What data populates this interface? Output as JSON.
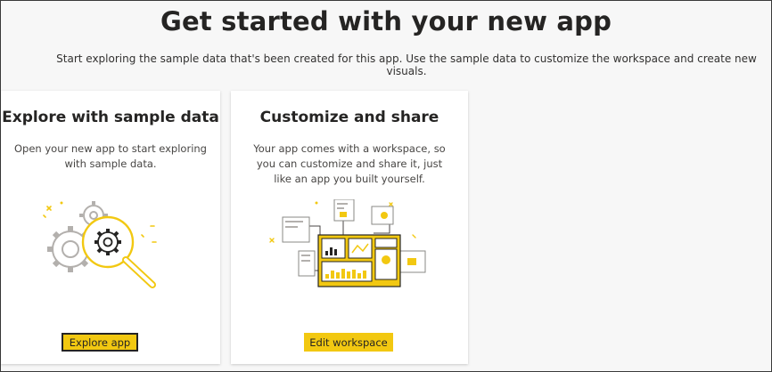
{
  "header": {
    "title": "Get started with your new app",
    "subtitle": "Start exploring the sample data that's been created for this app. Use the sample data to customize the workspace and create new visuals."
  },
  "cards": [
    {
      "title": "Explore with sample data",
      "body": "Open your new app to start exploring with sample data.",
      "button": "Explore app",
      "illustration": "magnifier-gears-icon"
    },
    {
      "title": "Customize and share",
      "body": "Your app comes with a workspace, so you can customize and share it, just like an app you built yourself.",
      "button": "Edit workspace",
      "illustration": "dashboard-reports-icon"
    }
  ],
  "colors": {
    "accent": "#f2c811",
    "text": "#252423",
    "muted_line": "#b3b0ad"
  }
}
